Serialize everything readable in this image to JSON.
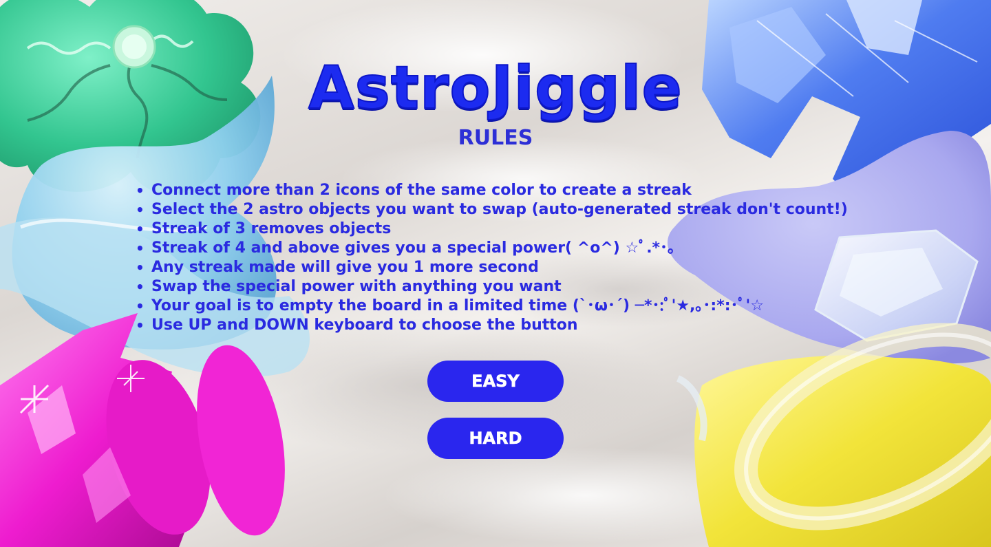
{
  "game": {
    "title": "AstroJiggle",
    "subtitle": "RULES",
    "rules": [
      "Connect more than 2 icons of the same color to create a streak",
      "Select the 2 astro objects you want to swap (auto-generated streak don't count!)",
      "Streak of 3 removes objects",
      "Streak of 4 and above gives you a special power( ^o^) ☆ﾟ.*･｡",
      "Any streak made will give you 1 more second",
      "Swap the special power with anything you want",
      "Your goal is to empty the board in a limited time (`･ω･´) ─*･:ﾟ'★,｡･:*:･ﾟ'☆",
      "Use UP and DOWN keyboard to choose the button"
    ],
    "buttons": {
      "easy": "EASY",
      "hard": "HARD"
    }
  },
  "colors": {
    "accent": "#2a26ee",
    "title": "#1c2bf0",
    "button_text": "#ffffff",
    "decor_green": "#3ecf9b",
    "decor_light_blue": "#8fd0ee",
    "decor_magenta": "#ee1ccf",
    "decor_blue_crystal": "#4f7cf0",
    "decor_lavender": "#a9a8ef",
    "decor_yellow": "#f2e43a"
  },
  "decorations": [
    "green-flower-object",
    "light-blue-wave-object",
    "magenta-crystal-object",
    "blue-crystal-object",
    "lavender-blob-object",
    "clear-diamond-object",
    "yellow-ring-object"
  ]
}
